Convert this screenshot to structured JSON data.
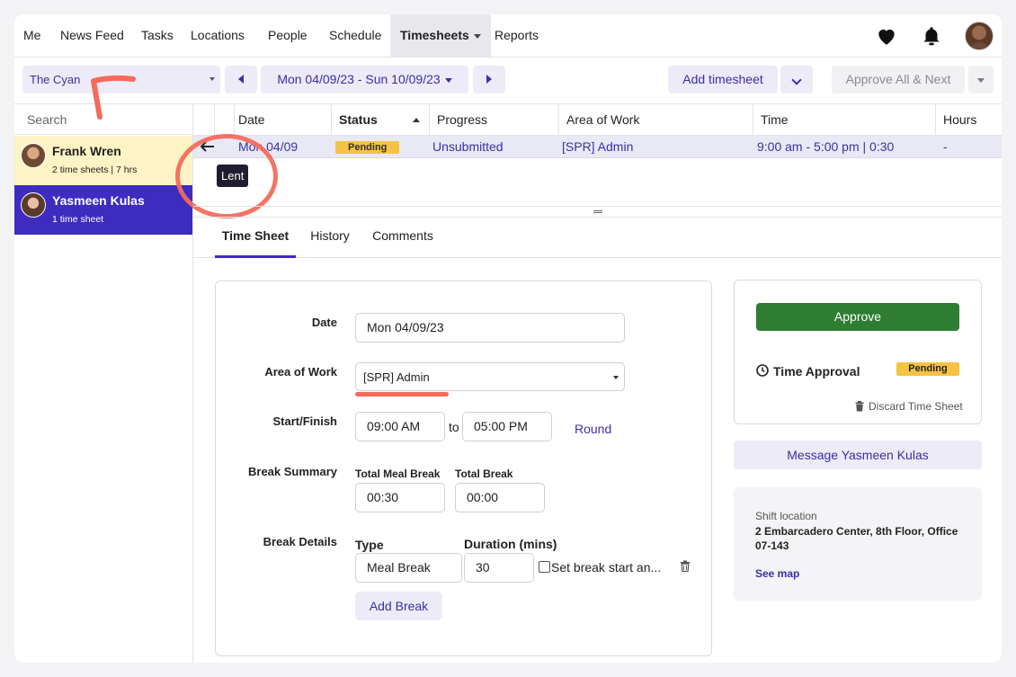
{
  "nav": {
    "items": [
      "Me",
      "News Feed",
      "Tasks",
      "Locations",
      "People",
      "Schedule",
      "Timesheets",
      "Reports"
    ]
  },
  "toolbar": {
    "location": "The Cyan",
    "date_range": "Mon 04/09/23 - Sun 10/09/23",
    "add_timesheet": "Add timesheet",
    "approve_next": "Approve All & Next"
  },
  "sidebar": {
    "search_placeholder": "Search",
    "people": [
      {
        "name": "Frank Wren",
        "sub": "2 time sheets | 7 hrs"
      },
      {
        "name": "Yasmeen Kulas",
        "sub": "1 time sheet"
      }
    ]
  },
  "table": {
    "headers": [
      "Date",
      "Status",
      "Progress",
      "Area of Work",
      "Time",
      "Hours"
    ],
    "row": {
      "date": "Mon 04/09",
      "status": "Pending",
      "progress": "Unsubmitted",
      "area": "[SPR] Admin",
      "time": "9:00 am - 5:00 pm | 0:30",
      "hours": "-"
    },
    "tooltip": "Lent"
  },
  "tabs": [
    "Time Sheet",
    "History",
    "Comments"
  ],
  "form": {
    "date_label": "Date",
    "date_value": "Mon 04/09/23",
    "area_label": "Area of Work",
    "area_value": "[SPR] Admin",
    "startfinish_label": "Start/Finish",
    "start_value": "09:00 AM",
    "to_text": "to",
    "finish_value": "05:00 PM",
    "round_link": "Round",
    "break_summary_label": "Break Summary",
    "total_meal_break_label": "Total Meal Break",
    "total_meal_break_value": "00:30",
    "total_break_label": "Total Break",
    "total_break_value": "00:00",
    "break_details_label": "Break Details",
    "type_label": "Type",
    "duration_label": "Duration (mins)",
    "break_type_value": "Meal Break",
    "break_duration_value": "30",
    "set_break_start_label": "Set break start an...",
    "add_break": "Add Break"
  },
  "approval": {
    "approve_button": "Approve",
    "time_approval_label": "Time Approval",
    "status": "Pending",
    "discard": "Discard Time Sheet"
  },
  "message_button": "Message Yasmeen Kulas",
  "shift": {
    "label": "Shift location",
    "address": "2 Embarcadero Center, 8th Floor, Office 07-143",
    "see_map": "See map"
  },
  "colors": {
    "accent": "#3e2bbf",
    "approve": "#2e7d32",
    "pending": "#f5c242",
    "annotation": "#f46a5c"
  }
}
